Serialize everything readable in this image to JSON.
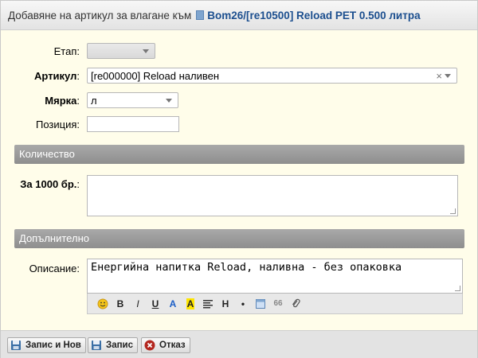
{
  "dialog": {
    "title_prefix": "Добавяне на артикул за влагане към",
    "title_link": "Bom26/[re10500] Reload PET 0.500 литра"
  },
  "form": {
    "stage_label": "Етап:",
    "stage_value": "",
    "article_label": "Артикул",
    "article_colon": ":",
    "article_value": "[re000000] Reload наливен",
    "unit_label": "Мярка",
    "unit_colon": ":",
    "unit_value": "л",
    "position_label": "Позиция:",
    "position_value": ""
  },
  "quantity_section": {
    "title": "Количество",
    "per1000_label": "За 1000 бр.",
    "per1000_colon": ":",
    "per1000_value": ""
  },
  "extra_section": {
    "title": "Допълнително",
    "description_label": "Описание:",
    "description_value": "Енергийна напитка Reload, наливна - без опаковка"
  },
  "toolbar": {
    "bold": "B",
    "italic": "I",
    "underline": "U",
    "font_color": "A",
    "highlight": "A",
    "heading": "H",
    "bullet": "•",
    "quote": "66"
  },
  "footer": {
    "save_new": "Запис и Нов",
    "save": "Запис",
    "cancel": "Отказ"
  },
  "colors": {
    "background": "#fffdea",
    "section_header": "#9b9b9b",
    "link": "#1c4f8f"
  }
}
